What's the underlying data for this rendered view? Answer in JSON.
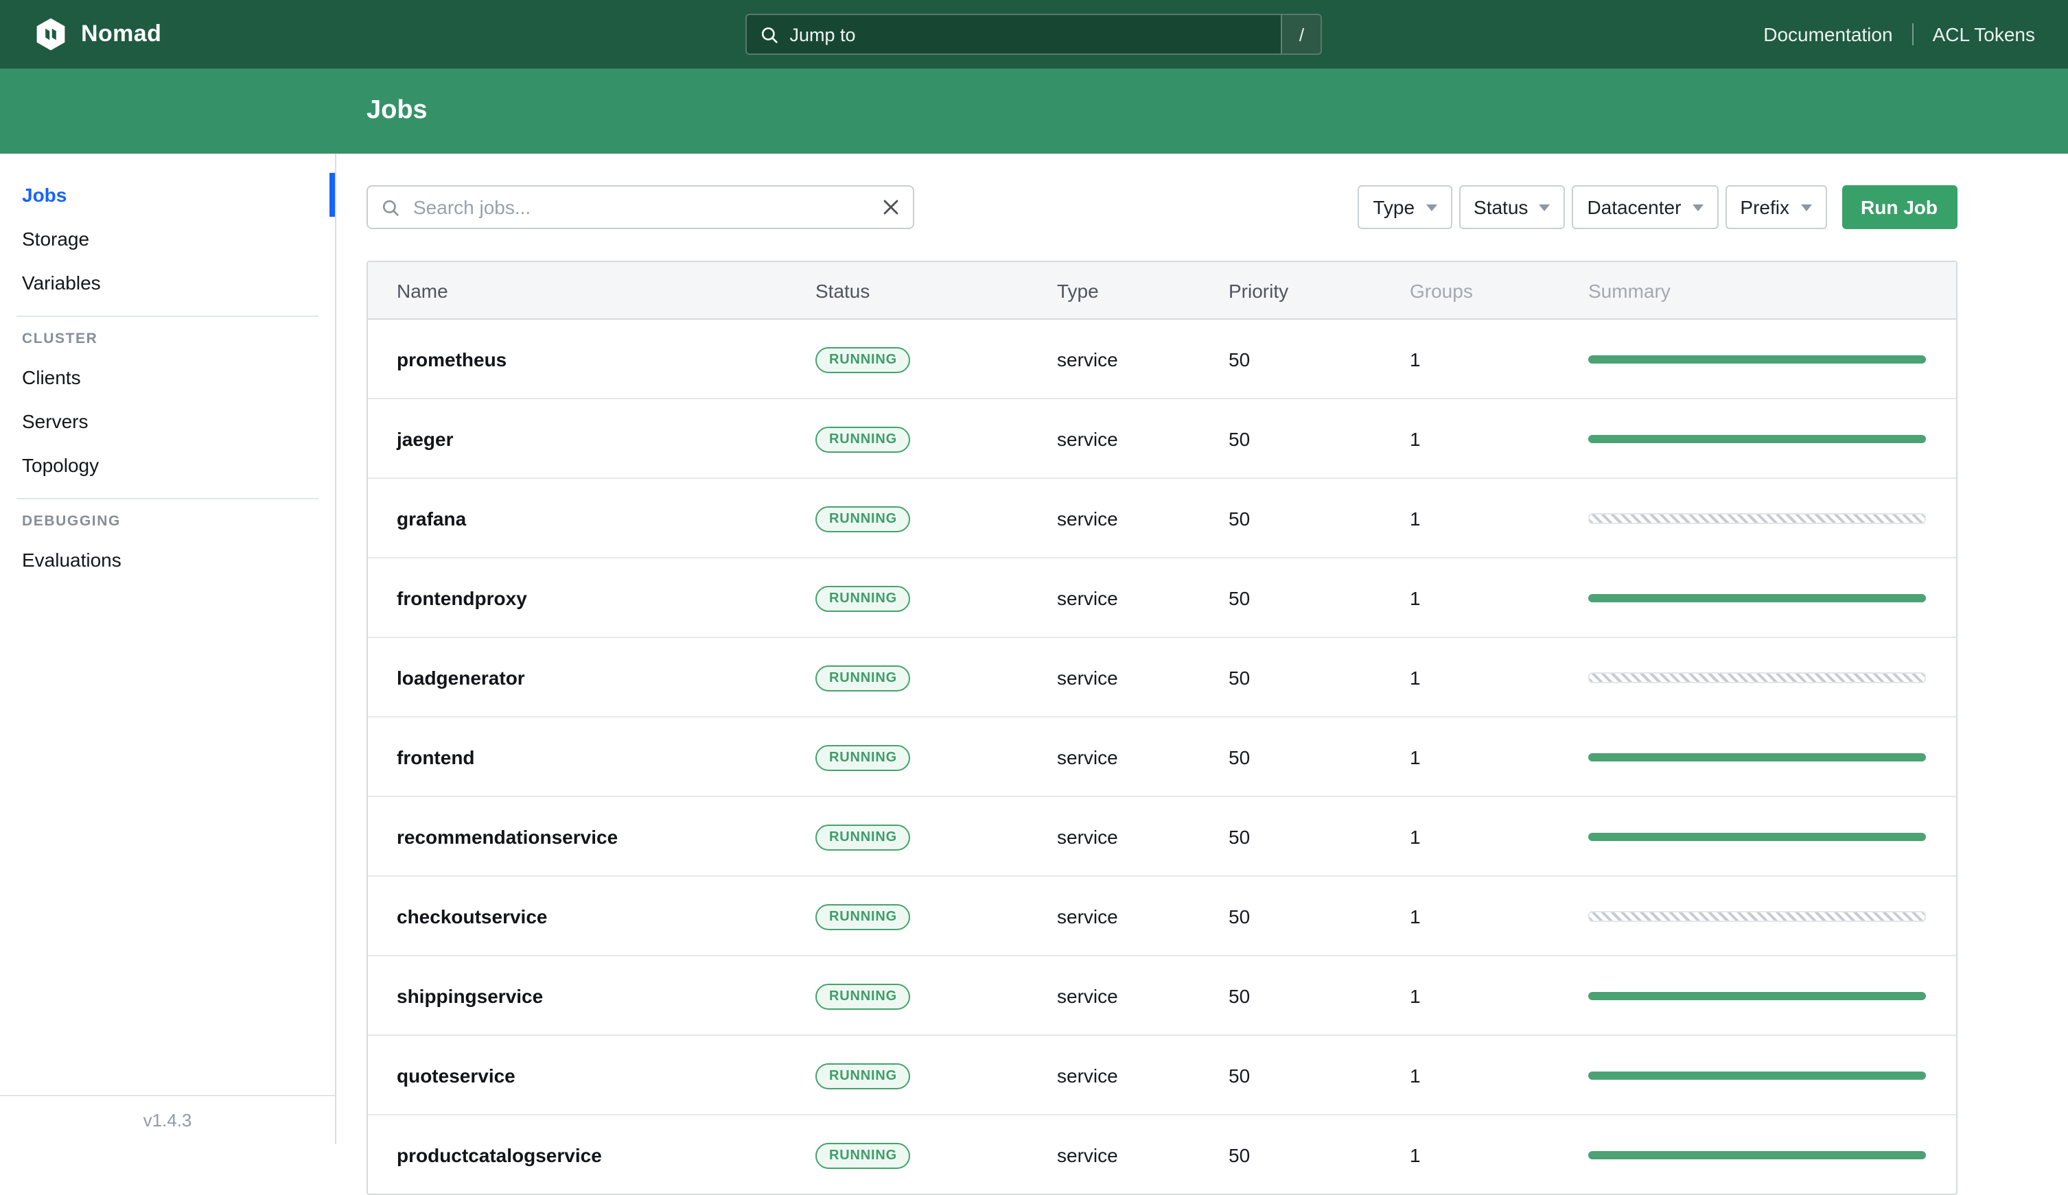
{
  "colors": {
    "navbar_bg": "#1e5b41",
    "subnav_bg": "#359268",
    "accent_blue": "#1563ff",
    "run_job_green": "#38a169",
    "badge_green": "#3d9e68",
    "summary_bar_green": "#4ba273"
  },
  "navbar": {
    "brand": "Nomad",
    "jump_to": "Jump to",
    "shortcut_key": "/",
    "links": [
      {
        "label": "Documentation"
      },
      {
        "label": "ACL Tokens"
      }
    ]
  },
  "page_header": {
    "title": "Jobs"
  },
  "sidebar": {
    "primary": [
      {
        "label": "Jobs",
        "active": true
      },
      {
        "label": "Storage",
        "active": false
      },
      {
        "label": "Variables",
        "active": false
      }
    ],
    "sections": [
      {
        "heading": "CLUSTER",
        "items": [
          {
            "label": "Clients"
          },
          {
            "label": "Servers"
          },
          {
            "label": "Topology"
          }
        ]
      },
      {
        "heading": "DEBUGGING",
        "items": [
          {
            "label": "Evaluations"
          }
        ]
      }
    ],
    "version": "v1.4.3"
  },
  "toolbar": {
    "search_placeholder": "Search jobs...",
    "filters": [
      {
        "label": "Type"
      },
      {
        "label": "Status"
      },
      {
        "label": "Datacenter"
      },
      {
        "label": "Prefix"
      }
    ],
    "run_job": "Run Job"
  },
  "table": {
    "columns": [
      {
        "label": "Name"
      },
      {
        "label": "Status"
      },
      {
        "label": "Type"
      },
      {
        "label": "Priority"
      },
      {
        "label": "Groups",
        "muted": true
      },
      {
        "label": "Summary",
        "muted": true
      }
    ],
    "rows": [
      {
        "name": "prometheus",
        "status": "RUNNING",
        "type": "service",
        "priority": "50",
        "groups": "1",
        "summary": "solid"
      },
      {
        "name": "jaeger",
        "status": "RUNNING",
        "type": "service",
        "priority": "50",
        "groups": "1",
        "summary": "solid"
      },
      {
        "name": "grafana",
        "status": "RUNNING",
        "type": "service",
        "priority": "50",
        "groups": "1",
        "summary": "striped"
      },
      {
        "name": "frontendproxy",
        "status": "RUNNING",
        "type": "service",
        "priority": "50",
        "groups": "1",
        "summary": "solid"
      },
      {
        "name": "loadgenerator",
        "status": "RUNNING",
        "type": "service",
        "priority": "50",
        "groups": "1",
        "summary": "striped"
      },
      {
        "name": "frontend",
        "status": "RUNNING",
        "type": "service",
        "priority": "50",
        "groups": "1",
        "summary": "solid"
      },
      {
        "name": "recommendationservice",
        "status": "RUNNING",
        "type": "service",
        "priority": "50",
        "groups": "1",
        "summary": "solid"
      },
      {
        "name": "checkoutservice",
        "status": "RUNNING",
        "type": "service",
        "priority": "50",
        "groups": "1",
        "summary": "striped"
      },
      {
        "name": "shippingservice",
        "status": "RUNNING",
        "type": "service",
        "priority": "50",
        "groups": "1",
        "summary": "solid"
      },
      {
        "name": "quoteservice",
        "status": "RUNNING",
        "type": "service",
        "priority": "50",
        "groups": "1",
        "summary": "solid"
      },
      {
        "name": "productcatalogservice",
        "status": "RUNNING",
        "type": "service",
        "priority": "50",
        "groups": "1",
        "summary": "solid"
      }
    ]
  }
}
